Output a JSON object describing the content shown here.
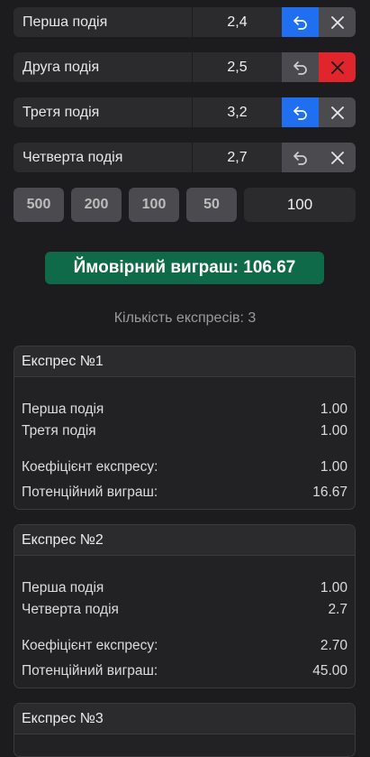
{
  "events": [
    {
      "name": "Перша подія",
      "coef": "2,4",
      "undo_active": true,
      "remove_danger": false
    },
    {
      "name": "Друга подія",
      "coef": "2,5",
      "undo_active": false,
      "remove_danger": true
    },
    {
      "name": "Третя подія",
      "coef": "3,2",
      "undo_active": true,
      "remove_danger": false
    },
    {
      "name": "Четверта подія",
      "coef": "2,7",
      "undo_active": false,
      "remove_danger": false
    }
  ],
  "stake": {
    "quick": [
      "500",
      "200",
      "100",
      "50"
    ],
    "value": "100"
  },
  "potential_win": "Ймовірний виграш: 106.67",
  "express_count": "Кількість експресів: 3",
  "expresses": [
    {
      "title": "Експрес №1",
      "events": [
        {
          "name": "Перша подія",
          "coef": "1.00"
        },
        {
          "name": "Третя подія",
          "coef": "1.00"
        }
      ],
      "coef_label": "Коефіцієнт експресу:",
      "coef_value": "1.00",
      "win_label": "Потенційний виграш:",
      "win_value": "16.67"
    },
    {
      "title": "Експрес №2",
      "events": [
        {
          "name": "Перша подія",
          "coef": "1.00"
        },
        {
          "name": "Четверта подія",
          "coef": "2.7"
        }
      ],
      "coef_label": "Коефіцієнт експресу:",
      "coef_value": "2.70",
      "win_label": "Потенційний виграш:",
      "win_value": "45.00"
    },
    {
      "title": "Експрес №3"
    }
  ],
  "colors": {
    "accent": "#1f6ff0",
    "danger": "#e0262c",
    "success": "#0f6a4a"
  }
}
